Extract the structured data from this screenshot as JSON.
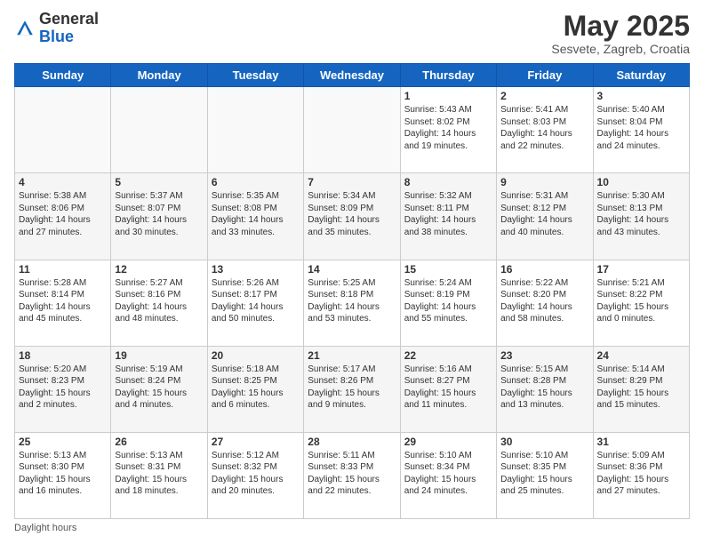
{
  "logo": {
    "general": "General",
    "blue": "Blue"
  },
  "header": {
    "month_year": "May 2025",
    "location": "Sesvete, Zagreb, Croatia"
  },
  "days_of_week": [
    "Sunday",
    "Monday",
    "Tuesday",
    "Wednesday",
    "Thursday",
    "Friday",
    "Saturday"
  ],
  "footer": {
    "daylight_label": "Daylight hours"
  },
  "weeks": [
    [
      {
        "day": "",
        "info": ""
      },
      {
        "day": "",
        "info": ""
      },
      {
        "day": "",
        "info": ""
      },
      {
        "day": "",
        "info": ""
      },
      {
        "day": "1",
        "info": "Sunrise: 5:43 AM\nSunset: 8:02 PM\nDaylight: 14 hours\nand 19 minutes."
      },
      {
        "day": "2",
        "info": "Sunrise: 5:41 AM\nSunset: 8:03 PM\nDaylight: 14 hours\nand 22 minutes."
      },
      {
        "day": "3",
        "info": "Sunrise: 5:40 AM\nSunset: 8:04 PM\nDaylight: 14 hours\nand 24 minutes."
      }
    ],
    [
      {
        "day": "4",
        "info": "Sunrise: 5:38 AM\nSunset: 8:06 PM\nDaylight: 14 hours\nand 27 minutes."
      },
      {
        "day": "5",
        "info": "Sunrise: 5:37 AM\nSunset: 8:07 PM\nDaylight: 14 hours\nand 30 minutes."
      },
      {
        "day": "6",
        "info": "Sunrise: 5:35 AM\nSunset: 8:08 PM\nDaylight: 14 hours\nand 33 minutes."
      },
      {
        "day": "7",
        "info": "Sunrise: 5:34 AM\nSunset: 8:09 PM\nDaylight: 14 hours\nand 35 minutes."
      },
      {
        "day": "8",
        "info": "Sunrise: 5:32 AM\nSunset: 8:11 PM\nDaylight: 14 hours\nand 38 minutes."
      },
      {
        "day": "9",
        "info": "Sunrise: 5:31 AM\nSunset: 8:12 PM\nDaylight: 14 hours\nand 40 minutes."
      },
      {
        "day": "10",
        "info": "Sunrise: 5:30 AM\nSunset: 8:13 PM\nDaylight: 14 hours\nand 43 minutes."
      }
    ],
    [
      {
        "day": "11",
        "info": "Sunrise: 5:28 AM\nSunset: 8:14 PM\nDaylight: 14 hours\nand 45 minutes."
      },
      {
        "day": "12",
        "info": "Sunrise: 5:27 AM\nSunset: 8:16 PM\nDaylight: 14 hours\nand 48 minutes."
      },
      {
        "day": "13",
        "info": "Sunrise: 5:26 AM\nSunset: 8:17 PM\nDaylight: 14 hours\nand 50 minutes."
      },
      {
        "day": "14",
        "info": "Sunrise: 5:25 AM\nSunset: 8:18 PM\nDaylight: 14 hours\nand 53 minutes."
      },
      {
        "day": "15",
        "info": "Sunrise: 5:24 AM\nSunset: 8:19 PM\nDaylight: 14 hours\nand 55 minutes."
      },
      {
        "day": "16",
        "info": "Sunrise: 5:22 AM\nSunset: 8:20 PM\nDaylight: 14 hours\nand 58 minutes."
      },
      {
        "day": "17",
        "info": "Sunrise: 5:21 AM\nSunset: 8:22 PM\nDaylight: 15 hours\nand 0 minutes."
      }
    ],
    [
      {
        "day": "18",
        "info": "Sunrise: 5:20 AM\nSunset: 8:23 PM\nDaylight: 15 hours\nand 2 minutes."
      },
      {
        "day": "19",
        "info": "Sunrise: 5:19 AM\nSunset: 8:24 PM\nDaylight: 15 hours\nand 4 minutes."
      },
      {
        "day": "20",
        "info": "Sunrise: 5:18 AM\nSunset: 8:25 PM\nDaylight: 15 hours\nand 6 minutes."
      },
      {
        "day": "21",
        "info": "Sunrise: 5:17 AM\nSunset: 8:26 PM\nDaylight: 15 hours\nand 9 minutes."
      },
      {
        "day": "22",
        "info": "Sunrise: 5:16 AM\nSunset: 8:27 PM\nDaylight: 15 hours\nand 11 minutes."
      },
      {
        "day": "23",
        "info": "Sunrise: 5:15 AM\nSunset: 8:28 PM\nDaylight: 15 hours\nand 13 minutes."
      },
      {
        "day": "24",
        "info": "Sunrise: 5:14 AM\nSunset: 8:29 PM\nDaylight: 15 hours\nand 15 minutes."
      }
    ],
    [
      {
        "day": "25",
        "info": "Sunrise: 5:13 AM\nSunset: 8:30 PM\nDaylight: 15 hours\nand 16 minutes."
      },
      {
        "day": "26",
        "info": "Sunrise: 5:13 AM\nSunset: 8:31 PM\nDaylight: 15 hours\nand 18 minutes."
      },
      {
        "day": "27",
        "info": "Sunrise: 5:12 AM\nSunset: 8:32 PM\nDaylight: 15 hours\nand 20 minutes."
      },
      {
        "day": "28",
        "info": "Sunrise: 5:11 AM\nSunset: 8:33 PM\nDaylight: 15 hours\nand 22 minutes."
      },
      {
        "day": "29",
        "info": "Sunrise: 5:10 AM\nSunset: 8:34 PM\nDaylight: 15 hours\nand 24 minutes."
      },
      {
        "day": "30",
        "info": "Sunrise: 5:10 AM\nSunset: 8:35 PM\nDaylight: 15 hours\nand 25 minutes."
      },
      {
        "day": "31",
        "info": "Sunrise: 5:09 AM\nSunset: 8:36 PM\nDaylight: 15 hours\nand 27 minutes."
      }
    ]
  ]
}
